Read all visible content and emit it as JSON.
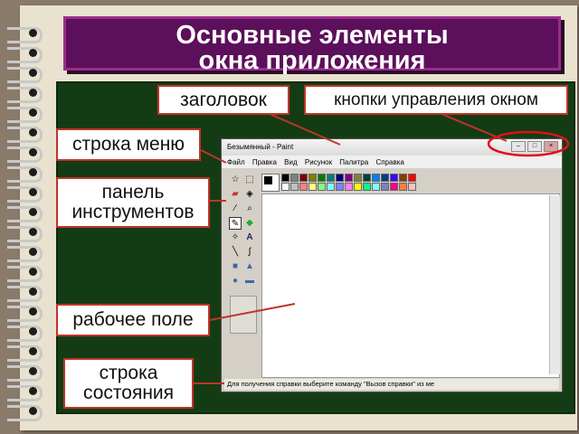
{
  "slide": {
    "title_line1": "Основные элементы",
    "title_line2": "окна приложения"
  },
  "labels": {
    "zagolovok": "заголовок",
    "knopki": "кнопки управления окном",
    "stroka_menu": "строка меню",
    "panel_line1": "панель",
    "panel_line2": "инструментов",
    "rabochee_pole": "рабочее поле",
    "stroka_line1": "строка",
    "stroka_line2": "состояния"
  },
  "paint": {
    "title": "Безымянный - Paint",
    "menu": [
      "Файл",
      "Правка",
      "Вид",
      "Рисунок",
      "Палитра",
      "Справка"
    ],
    "status_text": "Для получения справки выберите команду \"Вызов справки\" из ме",
    "palette_top": [
      "#000000",
      "#808080",
      "#800000",
      "#808000",
      "#008000",
      "#008080",
      "#000080",
      "#800080",
      "#808040",
      "#004040",
      "#0080ff",
      "#004080",
      "#4000ff",
      "#804000",
      "#ff0000"
    ],
    "palette_bottom": [
      "#ffffff",
      "#c0c0c0",
      "#ff8080",
      "#ffff80",
      "#80ff80",
      "#80ffff",
      "#8080ff",
      "#ff80ff",
      "#ffff00",
      "#00ff80",
      "#80ffff",
      "#8080c0",
      "#ff0080",
      "#ff8040",
      "#ffc0c0"
    ]
  },
  "colors": {
    "title_bg": "#5c0f5a",
    "panel_bg": "#143c14",
    "label_border": "#c0342a"
  }
}
